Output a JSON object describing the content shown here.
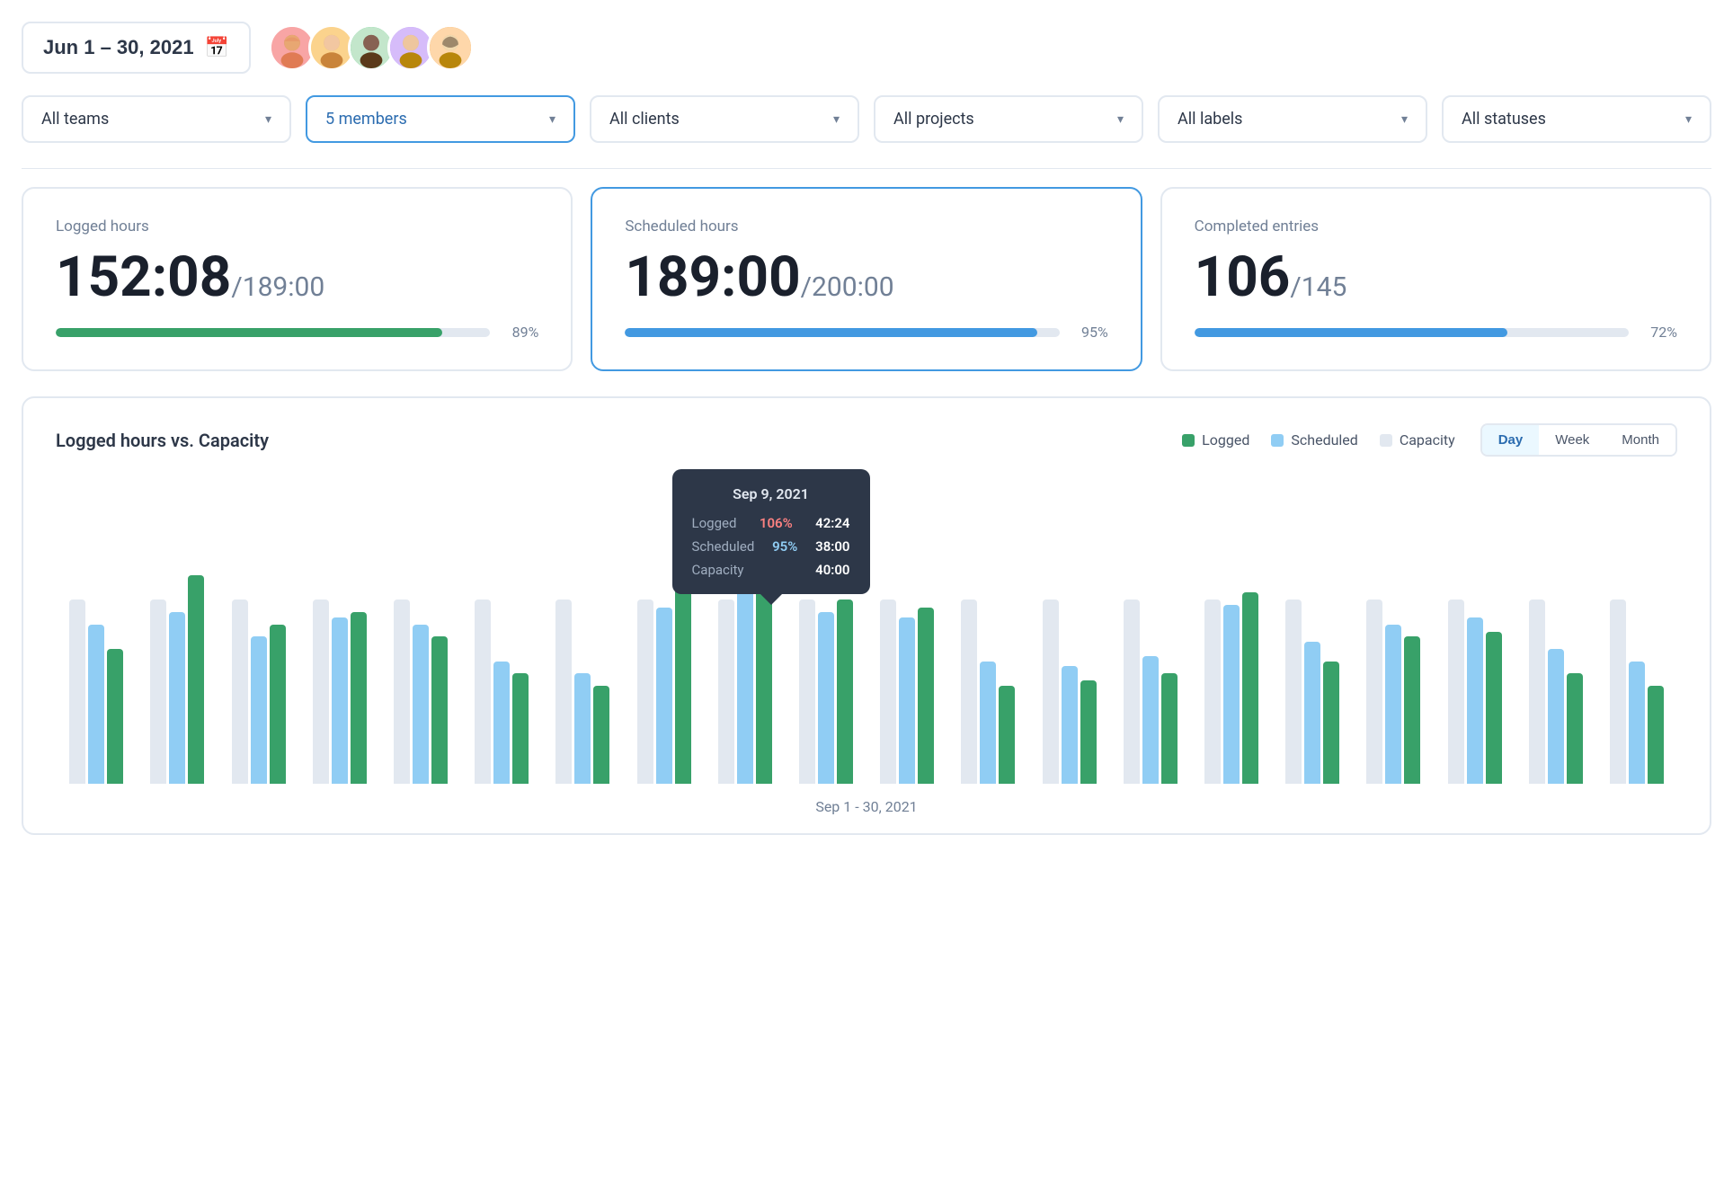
{
  "header": {
    "date_range": "Jun 1 – 30, 2021",
    "calendar_icon": "📅"
  },
  "avatars": [
    {
      "id": 1,
      "emoji": "👩‍🦰",
      "color": "#f8a5a5"
    },
    {
      "id": 2,
      "emoji": "👨",
      "color": "#fbd38d"
    },
    {
      "id": 3,
      "emoji": "👩🏿",
      "color": "#68d391"
    },
    {
      "id": 4,
      "emoji": "👩🏻‍🦱",
      "color": "#b794f4"
    },
    {
      "id": 5,
      "emoji": "👩",
      "color": "#f6ad55"
    }
  ],
  "filters": [
    {
      "label": "All teams",
      "active": false
    },
    {
      "label": "5 members",
      "active": true
    },
    {
      "label": "All clients",
      "active": false
    },
    {
      "label": "All projects",
      "active": false
    },
    {
      "label": "All labels",
      "active": false
    },
    {
      "label": "All statuses",
      "active": false
    }
  ],
  "stats": [
    {
      "label": "Logged hours",
      "value": "152:08",
      "secondary": "/189:00",
      "progress": 89,
      "progress_color": "#38a169",
      "highlighted": false
    },
    {
      "label": "Scheduled hours",
      "value": "189:00",
      "secondary": "/200:00",
      "progress": 95,
      "progress_color": "#4299e1",
      "highlighted": true
    },
    {
      "label": "Completed entries",
      "value": "106",
      "secondary": "/145",
      "progress": 72,
      "progress_color": "#4299e1",
      "highlighted": false
    }
  ],
  "chart": {
    "title": "Logged hours vs. Capacity",
    "legend": [
      {
        "label": "Logged",
        "color": "#38a169"
      },
      {
        "label": "Scheduled",
        "color": "#90cdf4"
      },
      {
        "label": "Capacity",
        "color": "#e2e8f0"
      }
    ],
    "view_buttons": [
      "Day",
      "Week",
      "Month"
    ],
    "active_view": "Day",
    "footer": "Sep 1 - 30, 2021",
    "tooltip": {
      "date": "Sep 9, 2021",
      "rows": [
        {
          "label": "Logged",
          "pct": "106%",
          "pct_color": "red",
          "value": "42:24"
        },
        {
          "label": "Scheduled",
          "pct": "95%",
          "pct_color": "blue",
          "value": "38:00"
        },
        {
          "label": "Capacity",
          "pct": "",
          "pct_color": "",
          "value": "40:00"
        }
      ]
    },
    "bars": [
      {
        "logged": 55,
        "scheduled": 65,
        "capacity": 75
      },
      {
        "logged": 85,
        "scheduled": 70,
        "capacity": 75
      },
      {
        "logged": 65,
        "scheduled": 60,
        "capacity": 75
      },
      {
        "logged": 70,
        "scheduled": 68,
        "capacity": 75
      },
      {
        "logged": 60,
        "scheduled": 65,
        "capacity": 75
      },
      {
        "logged": 45,
        "scheduled": 50,
        "capacity": 75
      },
      {
        "logged": 40,
        "scheduled": 45,
        "capacity": 75
      },
      {
        "logged": 80,
        "scheduled": 72,
        "capacity": 75
      },
      {
        "logged": 100,
        "scheduled": 80,
        "capacity": 75
      },
      {
        "logged": 75,
        "scheduled": 70,
        "capacity": 75
      },
      {
        "logged": 72,
        "scheduled": 68,
        "capacity": 75
      },
      {
        "logged": 40,
        "scheduled": 50,
        "capacity": 75
      },
      {
        "logged": 42,
        "scheduled": 48,
        "capacity": 75
      },
      {
        "logged": 45,
        "scheduled": 52,
        "capacity": 75
      },
      {
        "logged": 78,
        "scheduled": 73,
        "capacity": 75
      },
      {
        "logged": 50,
        "scheduled": 58,
        "capacity": 75
      },
      {
        "logged": 60,
        "scheduled": 65,
        "capacity": 75
      },
      {
        "logged": 62,
        "scheduled": 68,
        "capacity": 75
      },
      {
        "logged": 45,
        "scheduled": 55,
        "capacity": 75
      },
      {
        "logged": 40,
        "scheduled": 50,
        "capacity": 75
      }
    ]
  }
}
